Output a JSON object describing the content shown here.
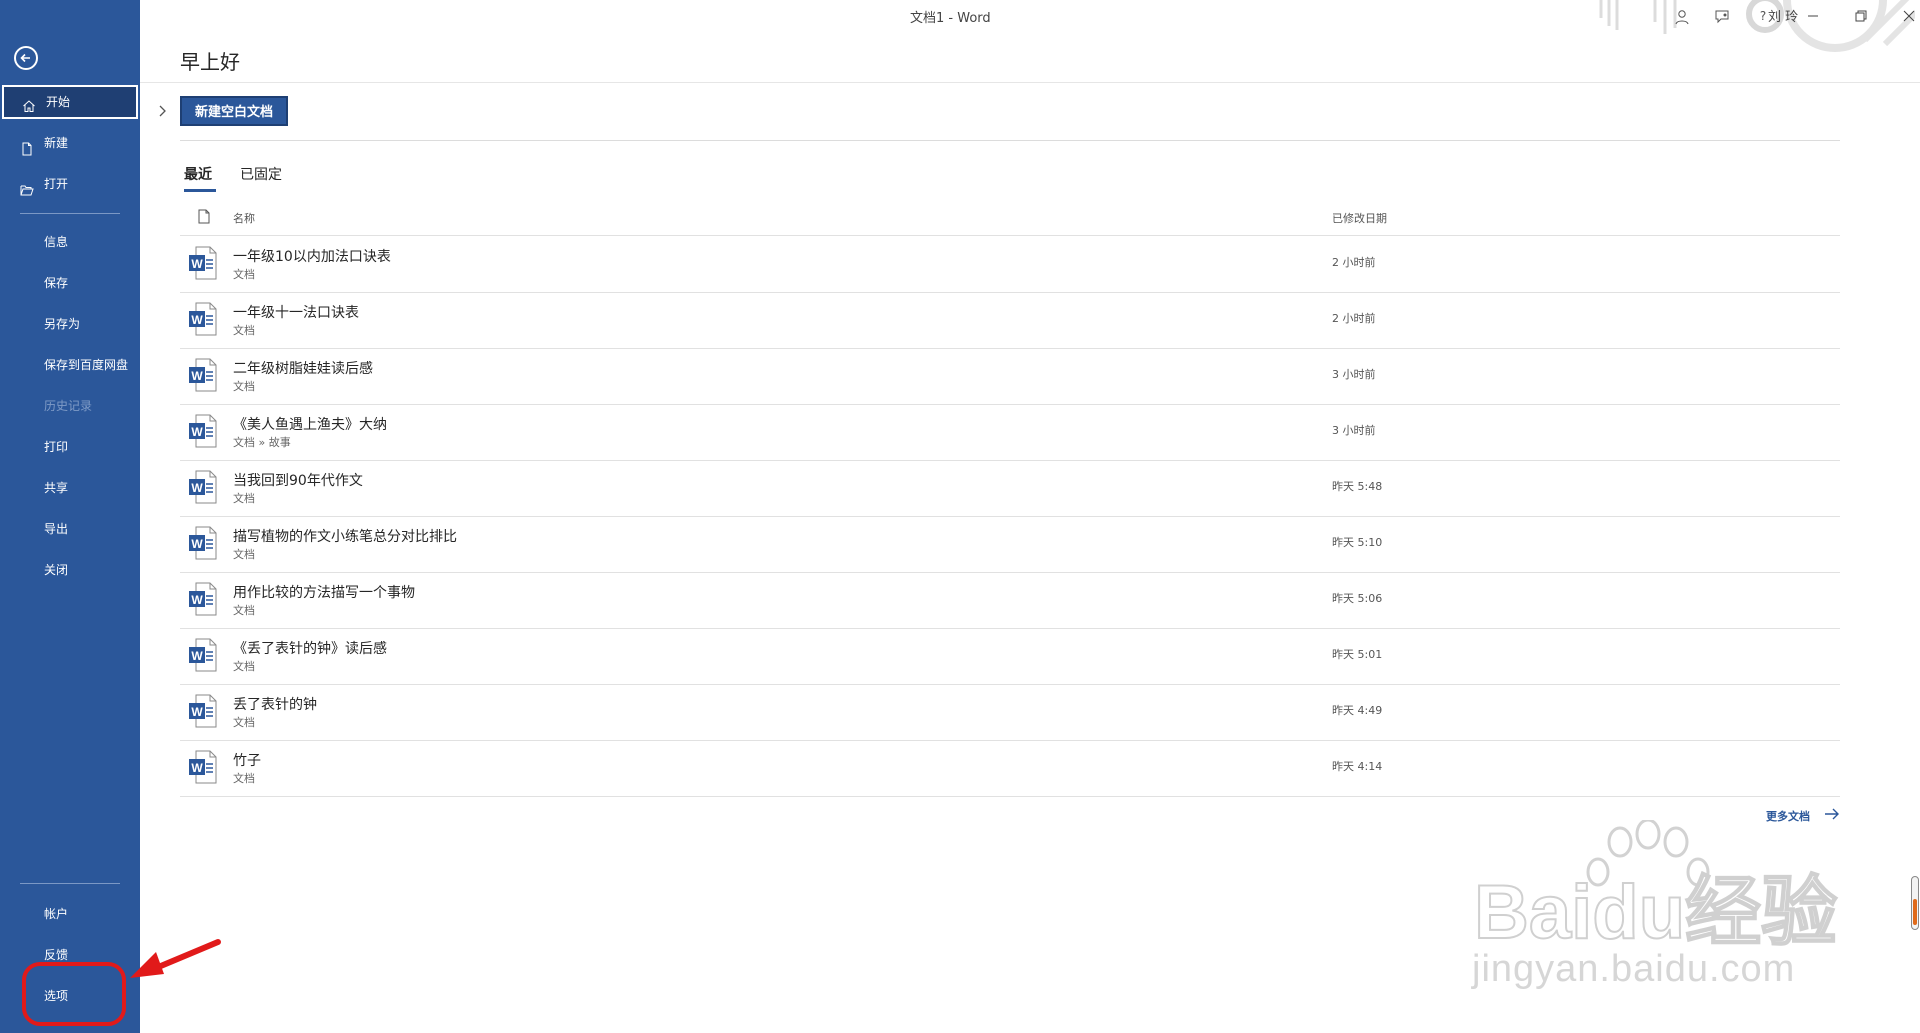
{
  "titlebar": {
    "doc_title": "文档1  -  Word",
    "user": "刘 玲",
    "help": "?"
  },
  "sidebar": {
    "items_top": [
      {
        "label": "开始",
        "icon": "home-icon",
        "active": true
      },
      {
        "label": "新建",
        "icon": "new-document-icon"
      },
      {
        "label": "打开",
        "icon": "open-folder-icon"
      }
    ],
    "items_mid": [
      {
        "label": "信息"
      },
      {
        "label": "保存"
      },
      {
        "label": "另存为"
      },
      {
        "label": "保存到百度网盘"
      },
      {
        "label": "历史记录",
        "disabled": true
      },
      {
        "label": "打印"
      },
      {
        "label": "共享"
      },
      {
        "label": "导出"
      },
      {
        "label": "关闭"
      }
    ],
    "items_bottom": [
      {
        "label": "帐户"
      },
      {
        "label": "反馈"
      },
      {
        "label": "选项",
        "highlighted": true
      }
    ],
    "color": "#2b579a"
  },
  "main": {
    "greeting": "早上好",
    "new_blank": "新建空白文档",
    "tabs": [
      {
        "label": "最近",
        "active": true
      },
      {
        "label": "已固定"
      }
    ],
    "columns": {
      "name": "名称",
      "modified": "已修改日期"
    },
    "files": [
      {
        "name": "一年级10以内加法口诀表",
        "location": "文档",
        "modified": "2 小时前"
      },
      {
        "name": "一年级十一法口诀表",
        "location": "文档",
        "modified": "2 小时前"
      },
      {
        "name": "二年级树脂娃娃读后感",
        "location": "文档",
        "modified": "3 小时前"
      },
      {
        "name": "《美人鱼遇上渔夫》大纳",
        "location": "文档 » 故事",
        "modified": "3 小时前"
      },
      {
        "name": "当我回到90年代作文",
        "location": "文档",
        "modified": "昨天 5:48"
      },
      {
        "name": "描写植物的作文小练笔总分对比排比",
        "location": "文档",
        "modified": "昨天 5:10"
      },
      {
        "name": "用作比较的方法描写一个事物",
        "location": "文档",
        "modified": "昨天 5:06"
      },
      {
        "name": "《丢了表针的钟》读后感",
        "location": "文档",
        "modified": "昨天 5:01"
      },
      {
        "name": "丢了表针的钟",
        "location": "文档",
        "modified": "昨天 4:49"
      },
      {
        "name": "竹子",
        "location": "文档",
        "modified": "昨天 4:14"
      }
    ],
    "more_docs": "更多文档"
  },
  "watermark": {
    "brand": "Baidu经验",
    "url": "jingyan.baidu.com"
  },
  "colors": {
    "accent": "#2b579a",
    "highlight_ring": "#e11a1a"
  }
}
